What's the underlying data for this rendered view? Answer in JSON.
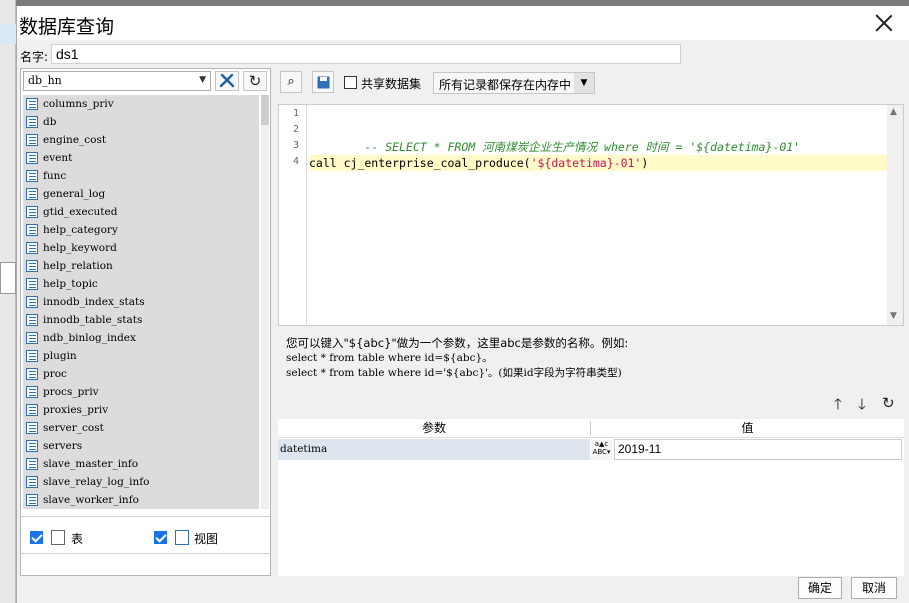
{
  "dialog": {
    "title": "数据库查询"
  },
  "name_row": {
    "label": "名字:",
    "value": "ds1"
  },
  "left_panel": {
    "database": "db_hn",
    "tables": [
      "columns_priv",
      "db",
      "engine_cost",
      "event",
      "func",
      "general_log",
      "gtid_executed",
      "help_category",
      "help_keyword",
      "help_relation",
      "help_topic",
      "innodb_index_stats",
      "innodb_table_stats",
      "ndb_binlog_index",
      "plugin",
      "proc",
      "procs_priv",
      "proxies_priv",
      "server_cost",
      "servers",
      "slave_master_info",
      "slave_relay_log_info",
      "slave_worker_info"
    ],
    "filter_table_label": "表",
    "filter_view_label": "视图"
  },
  "toolbar": {
    "share_label": "共享数据集",
    "mode_value": "所有记录都保存在内存中"
  },
  "editor": {
    "line_numbers": [
      "1",
      "2",
      "3",
      "4"
    ],
    "line2_comment": "-- SELECT * FROM 河南煤炭企业生产情况 where 时间 = '${datetima}-01'",
    "line4_call": "call cj_enterprise_coal_produce(",
    "line4_string": "'${datetima}-01'",
    "line4_close": ")"
  },
  "hint": {
    "line1": "您可以键入\"${abc}\"做为一个参数，这里abc是参数的名称。例如:",
    "line2": "select * from table where id=${abc}。",
    "line3": "select * from table where id='${abc}'。(如果id字段为字符串类型)"
  },
  "params": {
    "header_param": "参数",
    "header_value": "值",
    "rows": [
      {
        "name": "datetima",
        "type_icon": "abc-type-icon",
        "value": "2019-11"
      }
    ]
  },
  "footer": {
    "ok_label": "确定",
    "cancel_label": "取消"
  }
}
